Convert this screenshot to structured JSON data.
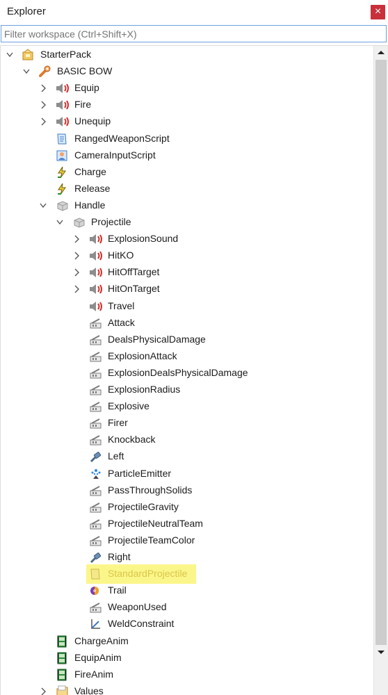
{
  "window": {
    "title": "Explorer",
    "close_label": "×"
  },
  "filter": {
    "placeholder": "Filter workspace (Ctrl+Shift+X)",
    "value": ""
  },
  "tree": [
    {
      "label": "StarterPack",
      "icon": "starterpack-icon",
      "expander": "expanded",
      "depth": 0
    },
    {
      "label": "BASIC BOW",
      "icon": "tool-icon",
      "expander": "expanded",
      "depth": 1
    },
    {
      "label": "Equip",
      "icon": "sound-icon",
      "expander": "collapsed",
      "depth": 2
    },
    {
      "label": "Fire",
      "icon": "sound-icon",
      "expander": "collapsed",
      "depth": 2
    },
    {
      "label": "Unequip",
      "icon": "sound-icon",
      "expander": "collapsed",
      "depth": 2
    },
    {
      "label": "RangedWeaponScript",
      "icon": "script-icon",
      "expander": "none",
      "depth": 2
    },
    {
      "label": "CameraInputScript",
      "icon": "localscript-icon",
      "expander": "none",
      "depth": 2
    },
    {
      "label": "Charge",
      "icon": "bindable-event-icon",
      "expander": "none",
      "depth": 2
    },
    {
      "label": "Release",
      "icon": "bindable-event-icon",
      "expander": "none",
      "depth": 2
    },
    {
      "label": "Handle",
      "icon": "part-icon",
      "expander": "expanded",
      "depth": 2
    },
    {
      "label": "Projectile",
      "icon": "part-icon",
      "expander": "expanded",
      "depth": 3
    },
    {
      "label": "ExplosionSound",
      "icon": "sound-icon",
      "expander": "collapsed",
      "depth": 4
    },
    {
      "label": "HitKO",
      "icon": "sound-icon",
      "expander": "collapsed",
      "depth": 4
    },
    {
      "label": "HitOffTarget",
      "icon": "sound-icon",
      "expander": "collapsed",
      "depth": 4
    },
    {
      "label": "HitOnTarget",
      "icon": "sound-icon",
      "expander": "collapsed",
      "depth": 4
    },
    {
      "label": "Travel",
      "icon": "sound-icon",
      "expander": "none",
      "depth": 4
    },
    {
      "label": "Attack",
      "icon": "value-icon",
      "expander": "none",
      "depth": 4
    },
    {
      "label": "DealsPhysicalDamage",
      "icon": "value-icon",
      "expander": "none",
      "depth": 4
    },
    {
      "label": "ExplosionAttack",
      "icon": "value-icon",
      "expander": "none",
      "depth": 4
    },
    {
      "label": "ExplosionDealsPhysicalDamage",
      "icon": "value-icon",
      "expander": "none",
      "depth": 4
    },
    {
      "label": "ExplosionRadius",
      "icon": "value-icon",
      "expander": "none",
      "depth": 4
    },
    {
      "label": "Explosive",
      "icon": "value-icon",
      "expander": "none",
      "depth": 4
    },
    {
      "label": "Firer",
      "icon": "value-icon",
      "expander": "none",
      "depth": 4
    },
    {
      "label": "Knockback",
      "icon": "value-icon",
      "expander": "none",
      "depth": 4
    },
    {
      "label": "Left",
      "icon": "attachment-icon",
      "expander": "none",
      "depth": 4
    },
    {
      "label": "ParticleEmitter",
      "icon": "particle-emitter-icon",
      "expander": "none",
      "depth": 4
    },
    {
      "label": "PassThroughSolids",
      "icon": "value-icon",
      "expander": "none",
      "depth": 4
    },
    {
      "label": "ProjectileGravity",
      "icon": "value-icon",
      "expander": "none",
      "depth": 4
    },
    {
      "label": "ProjectileNeutralTeam",
      "icon": "value-icon",
      "expander": "none",
      "depth": 4
    },
    {
      "label": "ProjectileTeamColor",
      "icon": "value-icon",
      "expander": "none",
      "depth": 4
    },
    {
      "label": "Right",
      "icon": "attachment-icon",
      "expander": "none",
      "depth": 4
    },
    {
      "label": "StandardProjectile",
      "icon": "modulescript-icon",
      "expander": "none",
      "depth": 4,
      "highlighted": true
    },
    {
      "label": "Trail",
      "icon": "trail-icon",
      "expander": "none",
      "depth": 4
    },
    {
      "label": "WeaponUsed",
      "icon": "value-icon",
      "expander": "none",
      "depth": 4
    },
    {
      "label": "WeldConstraint",
      "icon": "weld-constraint-icon",
      "expander": "none",
      "depth": 4
    },
    {
      "label": "ChargeAnim",
      "icon": "animation-icon",
      "expander": "none",
      "depth": 2
    },
    {
      "label": "EquipAnim",
      "icon": "animation-icon",
      "expander": "none",
      "depth": 2
    },
    {
      "label": "FireAnim",
      "icon": "animation-icon",
      "expander": "none",
      "depth": 2
    },
    {
      "label": "Values",
      "icon": "folder-icon",
      "expander": "collapsed",
      "depth": 2
    }
  ],
  "colors": {
    "highlight": "#fbf68a",
    "close": "#c9303a",
    "focus_border": "#6aa1dd"
  }
}
